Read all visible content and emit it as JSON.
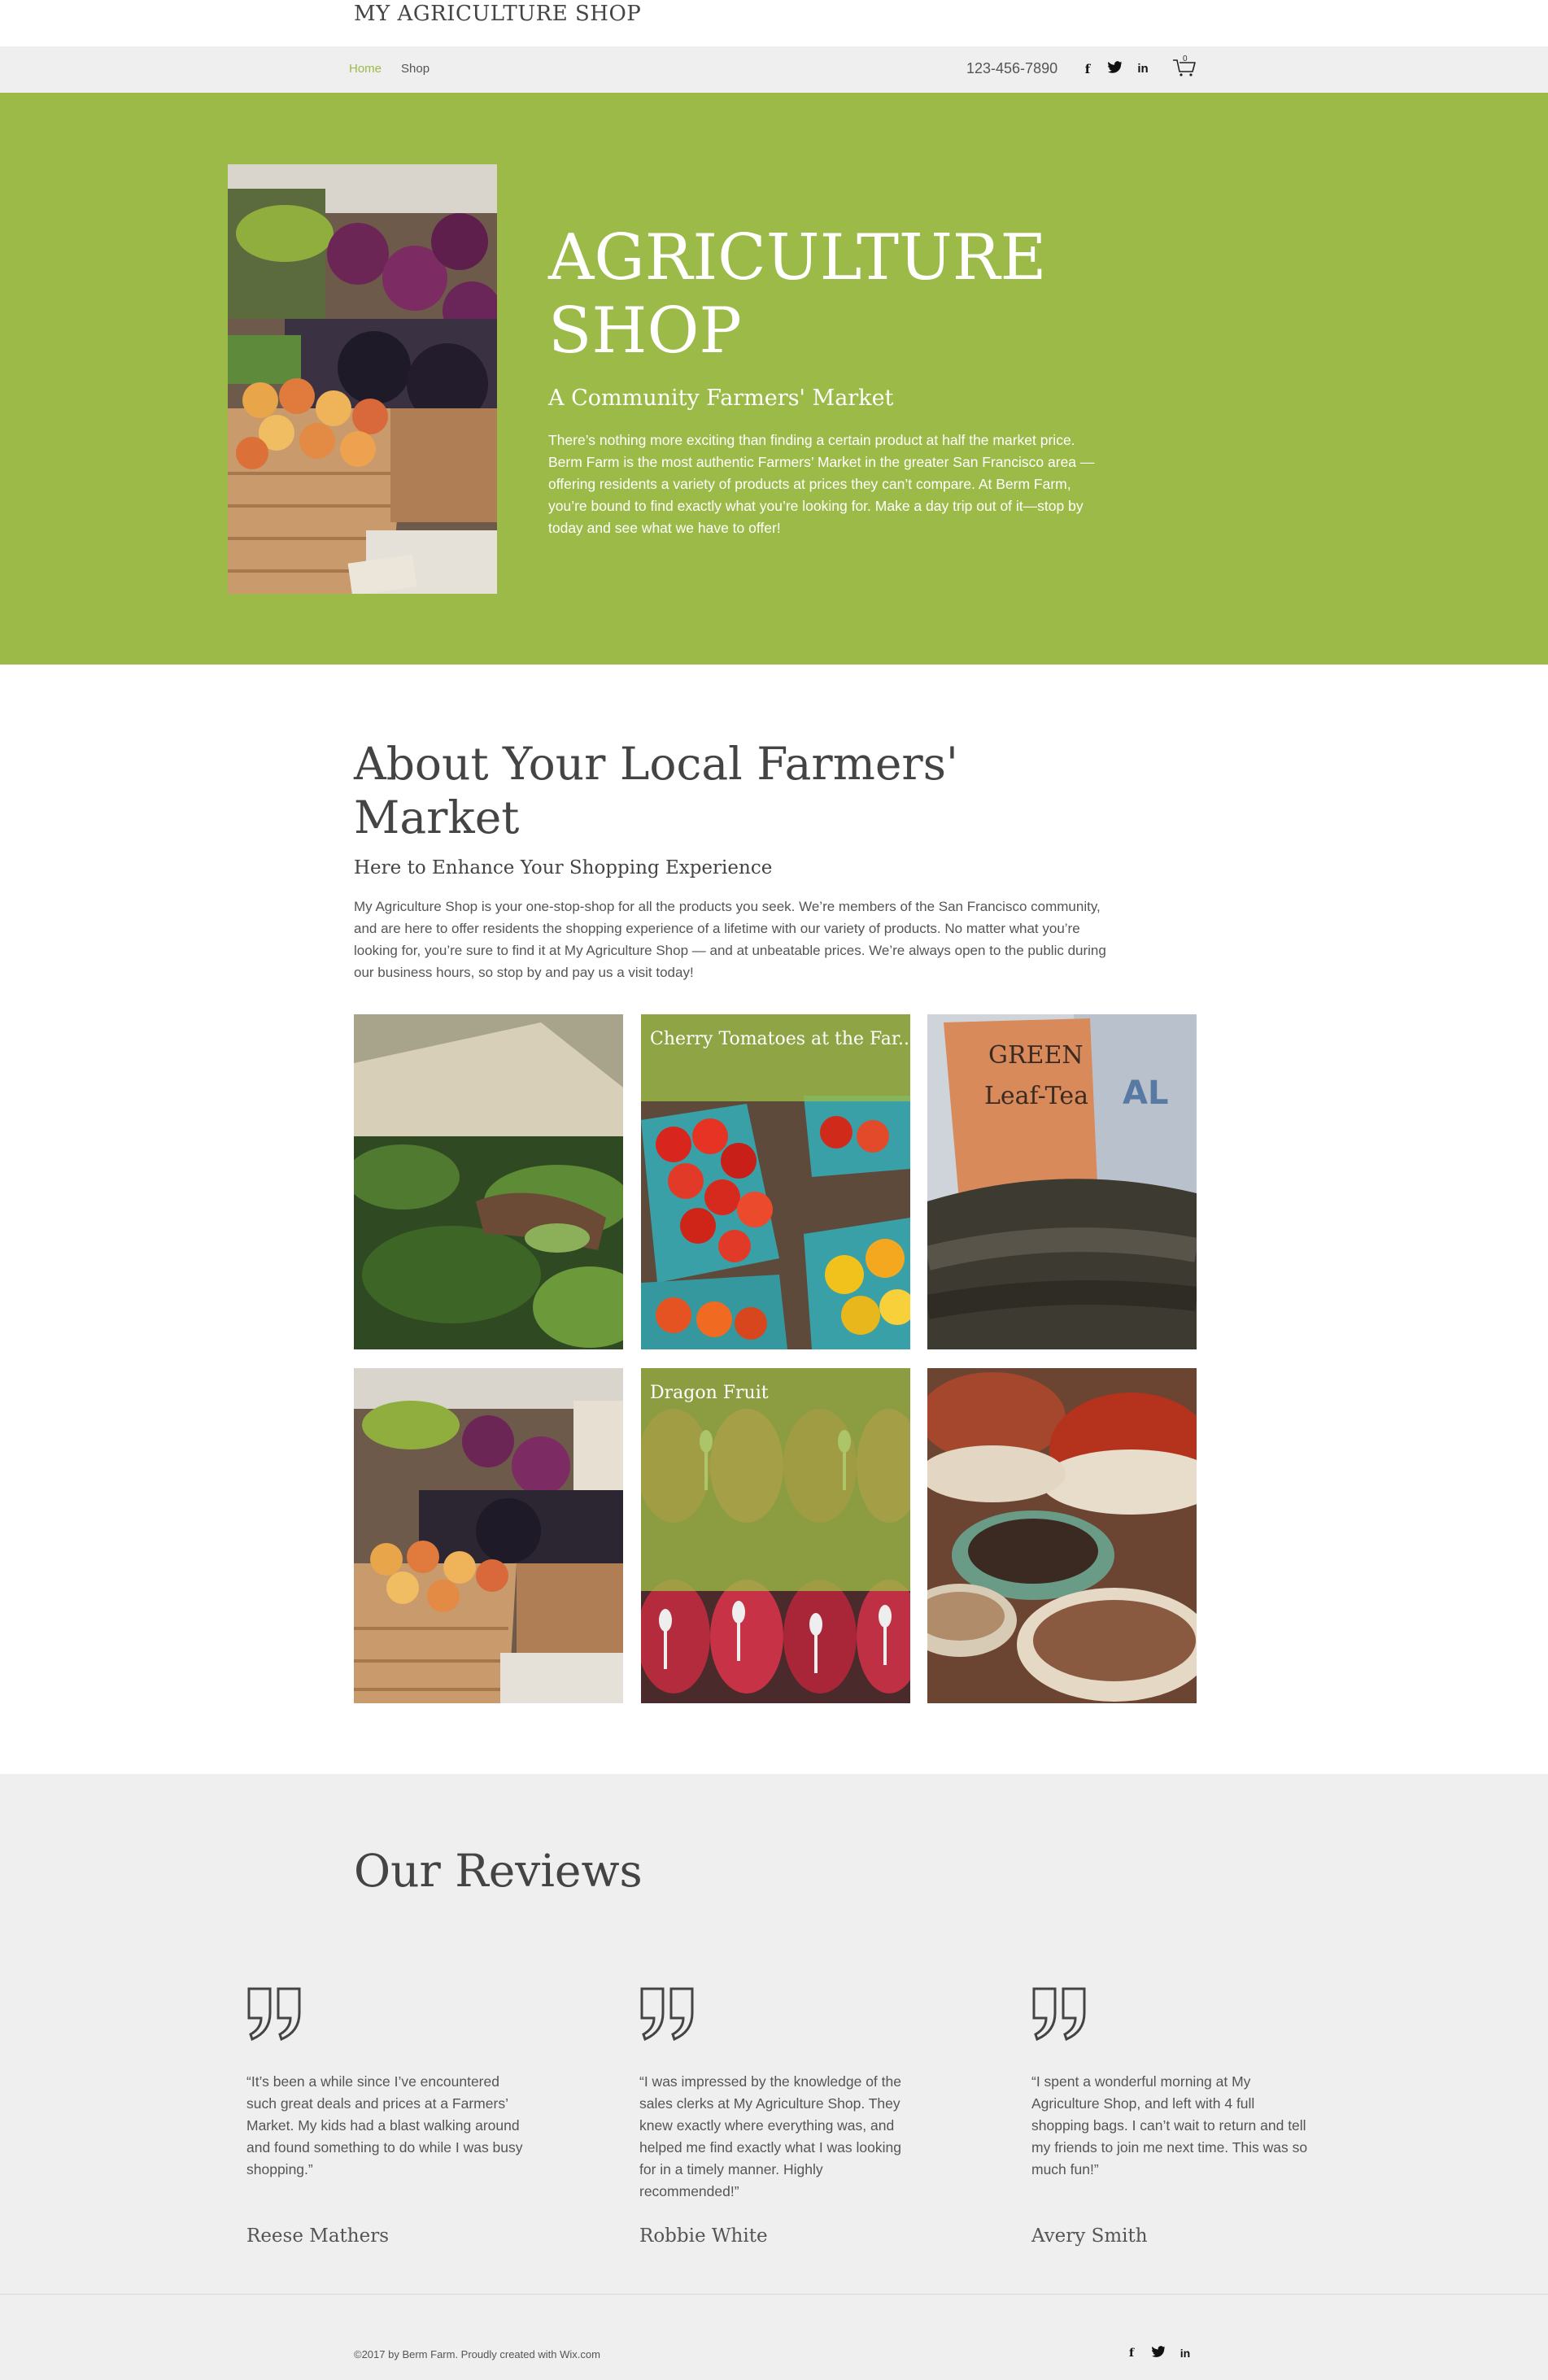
{
  "site": {
    "title": "MY AGRICULTURE SHOP"
  },
  "nav": {
    "items": [
      {
        "label": "Home",
        "active": true
      },
      {
        "label": "Shop",
        "active": false
      }
    ],
    "phone": "123-456-7890",
    "social_icons": [
      "facebook-icon",
      "twitter-icon",
      "linkedin-icon"
    ],
    "cart_count": "0"
  },
  "hero": {
    "title": "AGRICULTURE SHOP",
    "subtitle": "A Community Farmers' Market",
    "text": "There’s nothing more exciting than finding a certain product at half the market price. Berm Farm is the most authentic Farmers’ Market in the greater San Francisco area — offering residents a variety of products at prices they can’t compare. At Berm Farm, you’re bound to find exactly what you’re looking for. Make a day trip out of it—stop by today and see what we have to offer!"
  },
  "about": {
    "title": "About Your Local Farmers' Market",
    "subtitle": "Here to Enhance Your Shopping Experience",
    "text": "My Agriculture Shop is your one-stop-shop for all the products you seek. We’re members of the San Francisco community, and are here to offer residents the shopping experience of a lifetime with our variety of products. No matter what you’re looking for, you’re sure to find it at My Agriculture Shop — and at unbeatable prices. We’re always open to the public during our business hours, so stop by and pay us a visit today!"
  },
  "gallery": {
    "tiles": [
      {
        "label": ""
      },
      {
        "label": "Cherry Tomatoes at the Far..."
      },
      {
        "label": ""
      },
      {
        "label": ""
      },
      {
        "label": "Dragon Fruit"
      },
      {
        "label": ""
      }
    ]
  },
  "reviews": {
    "title": "Our Reviews",
    "items": [
      {
        "text": "“It’s been a while since I’ve encountered such great deals and prices at a Farmers’ Market. My kids had a blast walking around and found something to do while I was busy shopping.”",
        "name": "Reese Mathers"
      },
      {
        "text": "“I was impressed by the knowledge of the sales clerks at My Agriculture Shop. They knew exactly where everything was, and helped me find exactly what I was looking for in a timely manner. Highly recommended!”",
        "name": "Robbie White"
      },
      {
        "text": "“I spent a wonderful morning at My Agriculture Shop, and left with 4 full shopping bags. I can’t wait to return and tell my friends to join me next time. This was so much fun!”",
        "name": "Avery Smith"
      }
    ]
  },
  "footer": {
    "copyright": "©2017 by Berm Farm. Proudly created with Wix.com"
  },
  "colors": {
    "brand_green": "#9cba47",
    "panel_gray": "#efefef",
    "heading": "#444444"
  }
}
